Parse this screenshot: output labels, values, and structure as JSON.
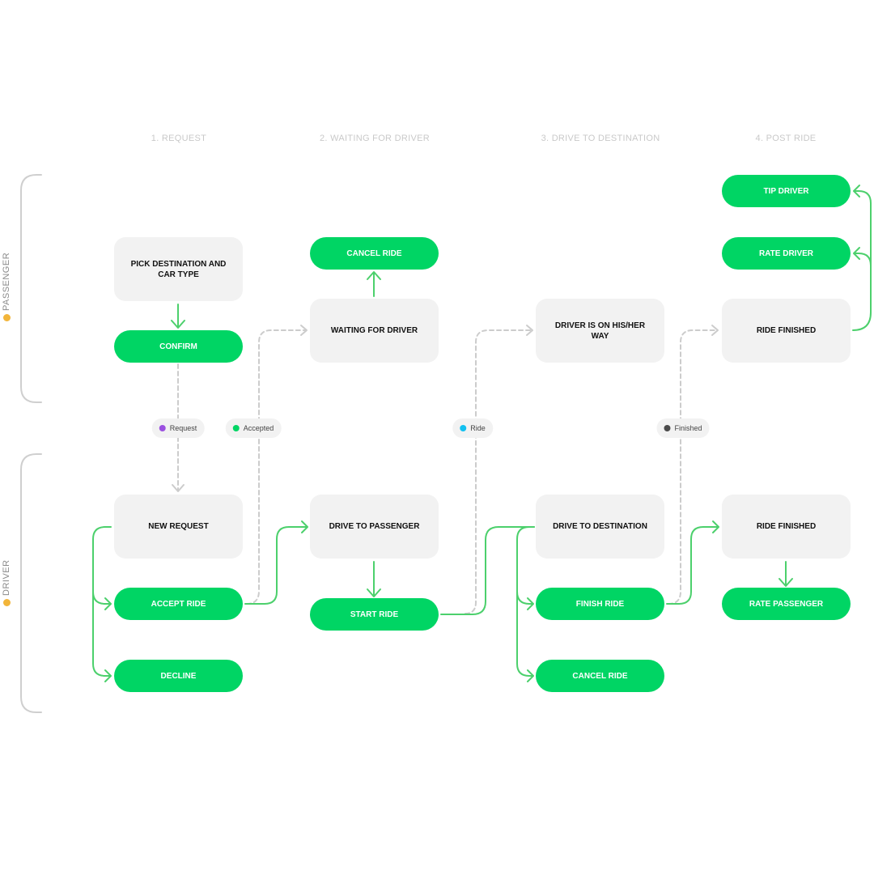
{
  "phases": [
    "1. REQUEST",
    "2. WAITING FOR DRIVER",
    "3. DRIVE TO DESTINATION",
    "4. POST RIDE"
  ],
  "lanes": {
    "passenger": {
      "label": "PASSENGER",
      "icon": "passenger-emoji-icon"
    },
    "driver": {
      "label": "DRIVER",
      "icon": "driver-emoji-icon"
    }
  },
  "passenger": {
    "pick_destination": "PICK DESTINATION AND CAR TYPE",
    "confirm": "CONFIRM",
    "cancel_ride": "CANCEL RIDE",
    "waiting_for_driver": "WAITING FOR DRIVER",
    "driver_on_way": "DRIVER IS ON HIS/HER WAY",
    "tip_driver": "TIP DRIVER",
    "rate_driver": "RATE DRIVER",
    "ride_finished": "RIDE FINISHED"
  },
  "driver": {
    "new_request": "NEW REQUEST",
    "accept_ride": "ACCEPT RIDE",
    "decline": "DECLINE",
    "drive_to_passenger": "DRIVE TO PASSENGER",
    "start_ride": "START RIDE",
    "drive_to_destination": "DRIVE TO DESTINATION",
    "finish_ride": "FINISH RIDE",
    "cancel_ride": "CANCEL RIDE",
    "ride_finished": "RIDE FINISHED",
    "rate_passenger": "RATE PASSENGER"
  },
  "events": [
    {
      "label": "Request",
      "color": "#9b51e0"
    },
    {
      "label": "Accepted",
      "color": "#00d564"
    },
    {
      "label": "Ride",
      "color": "#12c0f0"
    },
    {
      "label": "Finished",
      "color": "#4a4a4a"
    }
  ],
  "colors": {
    "action": "#00d564",
    "state": "#f2f2f2",
    "flow": "#4cd06c",
    "event_flow": "#cccccc"
  }
}
